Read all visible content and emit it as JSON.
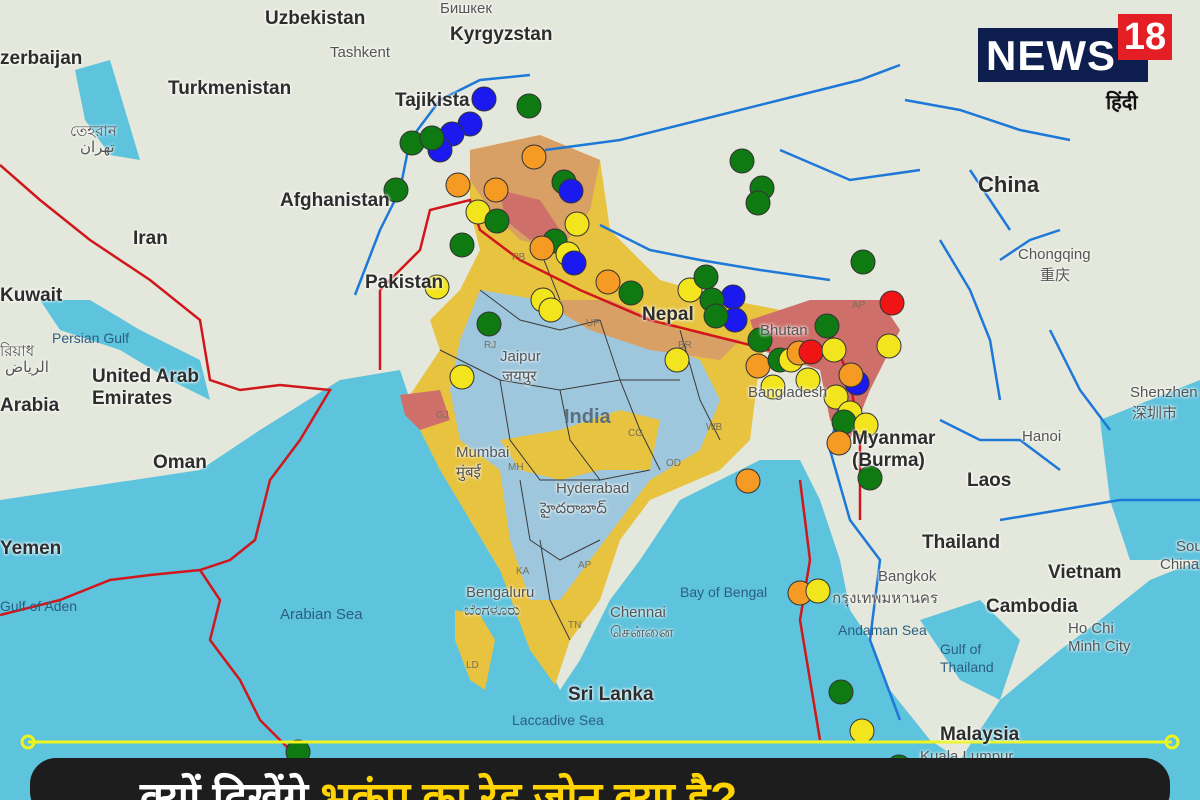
{
  "brand": {
    "name": "NEWS",
    "number": "18",
    "sub": "हिंदी"
  },
  "labels": {
    "uzbekistan": "Uzbekistan",
    "bishkek": "Бишкек",
    "kyrgyzstan": "Kyrgyzstan",
    "tashkent": "Tashkent",
    "azerbaijan": "zerbaijan",
    "turkmenistan": "Turkmenistan",
    "tehran_fa": "تهران",
    "tehran_bn": "তেহরান",
    "tajikistan": "Tajikista",
    "afghanistan": "Afghanistan",
    "iran": "Iran",
    "pakistan": "Pakistan",
    "kuwait": "Kuwait",
    "persian_gulf": "Persian Gulf",
    "riyadh_bn": "রিয়াধ",
    "riyadh_ar": "الرياض",
    "uae": "United Arab\nEmirates",
    "arabia": "Arabia",
    "oman": "Oman",
    "yemen": "Yemen",
    "gulf_aden": "Gulf of Aden",
    "arabian_sea": "Arabian Sea",
    "china": "China",
    "chongqing": "Chongqing",
    "chongqing_zh": "重庆",
    "shenzhen": "Shenzhen",
    "shenzhen_zh": "深圳市",
    "hanoi": "Hanoi",
    "laos": "Laos",
    "thailand": "Thailand",
    "vietnam": "Vietnam",
    "cambodia": "Cambodia",
    "bangkok": "Bangkok",
    "bangkok_th": "กรุงเทพมหานคร",
    "hcm": "Ho Chi\nMinh City",
    "gulf_thailand": "Gulf of\nThailand",
    "andaman_sea": "Andaman Sea",
    "myanmar": "Myanmar\n(Burma)",
    "bay_bengal": "Bay of Bengal",
    "chennai": "Chennai",
    "chennai_ta": "சென்னை",
    "bengaluru": "Bengaluru",
    "bengaluru_kn": "ಬೆಂಗಳೂರು",
    "sri_lanka": "Sri Lanka",
    "laccadive": "Laccadive Sea",
    "malaysia": "Malaysia",
    "kuala_lumpur": "Kuala Lumpur",
    "india": "India",
    "nepal": "Nepal",
    "bhutan": "Bhutan",
    "bangladesh": "Bangladesh",
    "jaipur": "Jaipur",
    "jaipur_hi": "जयपुर",
    "mumbai": "Mumbai",
    "mumbai_hi": "मुंबई",
    "hyderabad": "Hyderabad",
    "hyderabad_te": "హైదరాబాద్",
    "sou": "Sou",
    "china2": "China",
    "states": [
      "RJ",
      "GJ",
      "UP",
      "BR",
      "CG",
      "OD",
      "WB",
      "TN",
      "KA",
      "AP",
      "PB",
      "AP",
      "MH",
      "LD"
    ]
  },
  "headline": {
    "part1": "क्यों दिखेंगे",
    "part2": "भूकंप का रेड जोन क्या है?"
  },
  "colors": {
    "sea": "#5ec3dd",
    "land": "#e4e8dc",
    "zone2": "#9ec7dd",
    "zone3": "#e7c33f",
    "zone4": "#d9a066",
    "zone5": "#cf6f6a",
    "plate": "#d0171b",
    "fault": "#1e78d8",
    "quake_green": "#0f7a12",
    "quake_yellow": "#f3e51d",
    "quake_orange": "#f59a23",
    "quake_red": "#f11414",
    "quake_blue": "#1a1af0",
    "accent_line": "#ecf520"
  },
  "quake_legend": [
    "green",
    "yellow",
    "orange",
    "red",
    "blue"
  ]
}
